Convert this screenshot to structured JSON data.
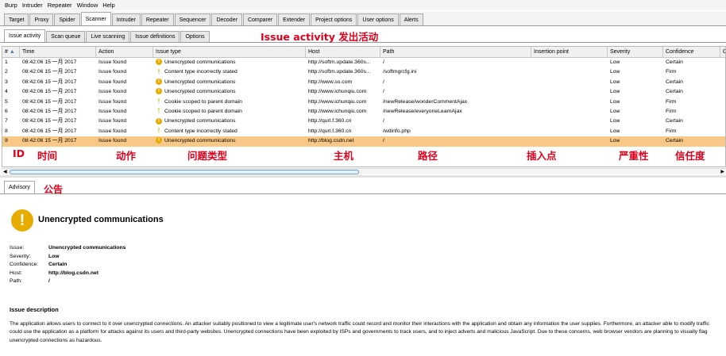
{
  "menu": [
    "Burp",
    "Intruder",
    "Repeater",
    "Window",
    "Help"
  ],
  "main_tabs": [
    "Target",
    "Proxy",
    "Spider",
    "Scanner",
    "Intruder",
    "Repeater",
    "Sequencer",
    "Decoder",
    "Comparer",
    "Extender",
    "Project options",
    "User options",
    "Alerts"
  ],
  "sub_tabs": [
    "Issue activity",
    "Scan queue",
    "Live scanning",
    "Issue definitions",
    "Options"
  ],
  "annotation_title": "Issue activity 发出活动",
  "columns": [
    "#",
    "Time",
    "Action",
    "Issue type",
    "Host",
    "Path",
    "Insertion point",
    "Severity",
    "Confidence",
    "C"
  ],
  "sort_indicator": "▲",
  "rows": [
    {
      "num": "1",
      "time": "08:42:06 15 一月 2017",
      "action": "Issue found",
      "issue": "Unencrypted communications",
      "icon": "!",
      "host": "http://softm.update.360s...",
      "path": "/",
      "insertion": "",
      "severity": "Low",
      "confidence": "Certain"
    },
    {
      "num": "2",
      "time": "08:42:06 15 一月 2017",
      "action": "Issue found",
      "issue": "Content type incorrectly stated",
      "icon": "i",
      "host": "http://softm.update.360s...",
      "path": "/softmgrcfg.ini",
      "insertion": "",
      "severity": "Low",
      "confidence": "Firm"
    },
    {
      "num": "3",
      "time": "08:42:06 15 一月 2017",
      "action": "Issue found",
      "issue": "Unencrypted communications",
      "icon": "!",
      "host": "http://www.so.com",
      "path": "/",
      "insertion": "",
      "severity": "Low",
      "confidence": "Certain"
    },
    {
      "num": "4",
      "time": "08:42:06 15 一月 2017",
      "action": "Issue found",
      "issue": "Unencrypted communications",
      "icon": "!",
      "host": "http://www.ichunqiu.com",
      "path": "/",
      "insertion": "",
      "severity": "Low",
      "confidence": "Certain"
    },
    {
      "num": "5",
      "time": "08:42:06 15 一月 2017",
      "action": "Issue found",
      "issue": "Cookie scoped to parent domain",
      "icon": "i",
      "host": "http://www.ichunqiu.com",
      "path": "/newRelease/wonderCommentAjax",
      "insertion": "",
      "severity": "Low",
      "confidence": "Firm"
    },
    {
      "num": "6",
      "time": "08:42:06 15 一月 2017",
      "action": "Issue found",
      "issue": "Cookie scoped to parent domain",
      "icon": "i",
      "host": "http://www.ichunqiu.com",
      "path": "/newRelease/everyoneLearnAjax",
      "insertion": "",
      "severity": "Low",
      "confidence": "Firm"
    },
    {
      "num": "7",
      "time": "08:42:06 15 一月 2017",
      "action": "Issue found",
      "issue": "Unencrypted communications",
      "icon": "!",
      "host": "http://qurl.f.360.cn",
      "path": "/",
      "insertion": "",
      "severity": "Low",
      "confidence": "Certain"
    },
    {
      "num": "8",
      "time": "08:42:06 15 一月 2017",
      "action": "Issue found",
      "issue": "Content type incorrectly stated",
      "icon": "i",
      "host": "http://qurl.f.360.cn",
      "path": "/wdinfo.php",
      "insertion": "",
      "severity": "Low",
      "confidence": "Firm"
    },
    {
      "num": "9",
      "time": "08:42:06 15 一月 2017",
      "action": "Issue found",
      "issue": "Unencrypted communications",
      "icon": "!",
      "host": "http://blog.csdn.net",
      "path": "/",
      "insertion": "",
      "severity": "Low",
      "confidence": "Certain"
    }
  ],
  "column_annotations": [
    "ID",
    "时间",
    "动作",
    "问题类型",
    "主机",
    "路径",
    "插入点",
    "严重性",
    "信任度"
  ],
  "advisory_tab": "Advisory",
  "advisory_annotation": "公告",
  "advisory": {
    "icon": "!",
    "title": "Unencrypted communications",
    "details": [
      {
        "label": "Issue:",
        "value": "Unencrypted communications"
      },
      {
        "label": "Severity:",
        "value": "Low"
      },
      {
        "label": "Confidence:",
        "value": "Certain"
      },
      {
        "label": "Host:",
        "value": "http://blog.csdn.net"
      },
      {
        "label": "Path:",
        "value": "/"
      }
    ],
    "description_heading": "Issue description",
    "description": "The application allows users to connect to it over unencrypted connections. An attacker suitably positioned to view a legitimate user's network traffic could record and monitor their interactions with the application and obtain any information the user supplies. Furthermore, an attacker able to modify traffic could use the application as a platform for attacks against its users and third-party websites. Unencrypted connections have been exploited by ISPs and governments to track users, and to inject adverts and malicious JavaScript. Due to these concerns, web browser vendors are planning to visually flag unencrypted connections as hazardous."
  },
  "colors": {
    "selected_row": "#fac886",
    "annotation_red": "#e0001b",
    "warning_yellow": "#e6ad00"
  }
}
